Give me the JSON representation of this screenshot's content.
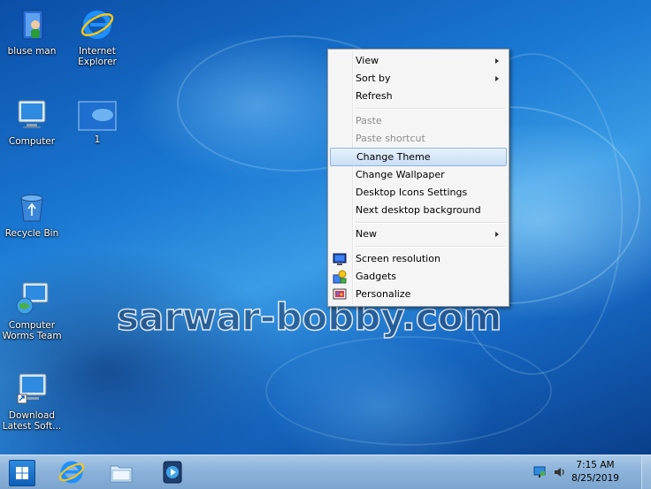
{
  "desktop": {
    "icons": [
      {
        "label": "bluse man",
        "icon": "user-folder-icon"
      },
      {
        "label": "Internet Explorer",
        "icon": "internet-explorer-icon"
      },
      {
        "label": "Computer",
        "icon": "computer-icon"
      },
      {
        "label": "1",
        "icon": "image-thumbnail-icon"
      },
      {
        "label": "Recycle Bin",
        "icon": "recycle-bin-icon"
      },
      {
        "label": "Computer Worms Team",
        "icon": "network-computer-icon"
      },
      {
        "label": "Download Latest Soft...",
        "icon": "computer-shortcut-icon"
      }
    ],
    "watermark": "sarwar-bobby.com"
  },
  "context_menu": {
    "view": "View",
    "sort_by": "Sort by",
    "refresh": "Refresh",
    "paste": "Paste",
    "paste_shortcut": "Paste shortcut",
    "change_theme": "Change Theme",
    "change_wallpaper": "Change Wallpaper",
    "desktop_icons_settings": "Desktop Icons Settings",
    "next_desktop_background": "Next desktop background",
    "new": "New",
    "screen_resolution": "Screen resolution",
    "gadgets": "Gadgets",
    "personalize": "Personalize",
    "highlighted": "Change Theme"
  },
  "taskbar": {
    "pinned": [
      "start-button",
      "internet-explorer-icon",
      "file-explorer-icon",
      "media-player-icon"
    ],
    "clock_time": "7:15 AM",
    "clock_date": "8/25/2019",
    "tray": [
      "action-center-flag-icon",
      "speaker-icon"
    ]
  },
  "colors": {
    "desktop_blue": "#1a78d2",
    "menu_highlight": "#c9def5",
    "taskbar": "#8eb4da"
  }
}
